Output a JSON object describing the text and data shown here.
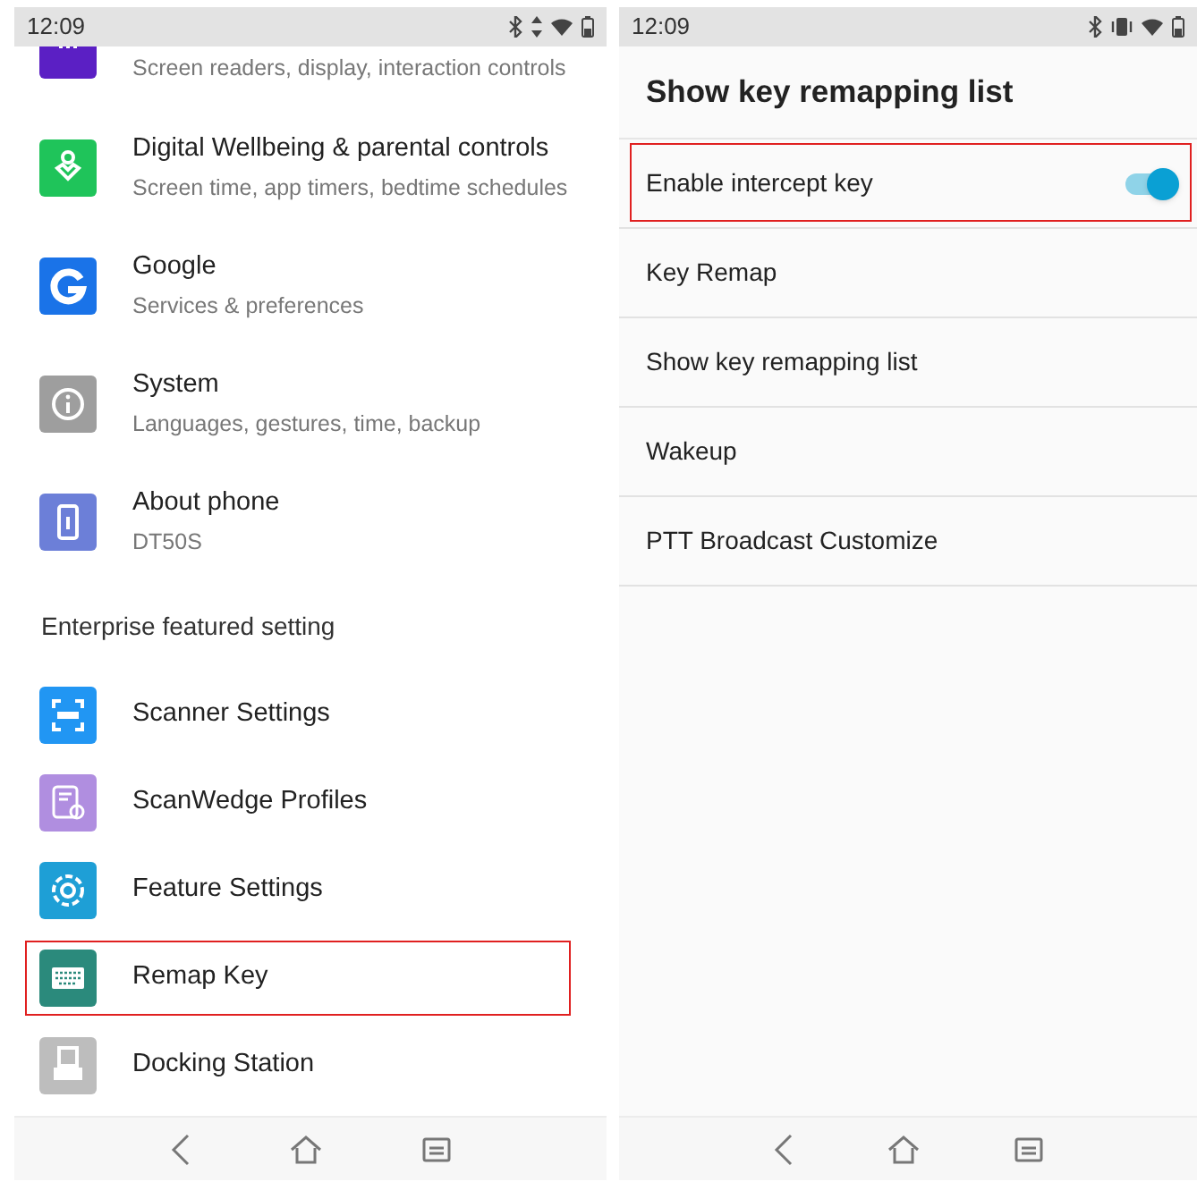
{
  "left_phone": {
    "status_bar": {
      "time": "12:09"
    },
    "items": [
      {
        "subtitle": "Screen readers, display, interaction controls",
        "color": "#5b1fc4",
        "partial": true
      },
      {
        "title": "Digital Wellbeing & parental controls",
        "subtitle": "Screen time, app timers, bedtime schedules",
        "color": "#1fc45a"
      },
      {
        "title": "Google",
        "subtitle": "Services & preferences",
        "color": "#1a73e8"
      },
      {
        "title": "System",
        "subtitle": "Languages, gestures, time, backup",
        "color": "#9e9e9e"
      },
      {
        "title": "About phone",
        "subtitle": "DT50S",
        "color": "#6c7fd8"
      }
    ],
    "section_header": "Enterprise featured setting",
    "enterprise_items": [
      {
        "title": "Scanner Settings",
        "color": "#2196f3",
        "highlighted": false
      },
      {
        "title": "ScanWedge Profiles",
        "color": "#b08ee0",
        "highlighted": false
      },
      {
        "title": "Feature Settings",
        "color": "#1e9fd6",
        "highlighted": false
      },
      {
        "title": "Remap Key",
        "color": "#2b8a7c",
        "highlighted": true
      },
      {
        "title": "Docking Station",
        "color": "#bdbdbd",
        "highlighted": false
      }
    ]
  },
  "right_phone": {
    "status_bar": {
      "time": "12:09"
    },
    "title": "Show key remapping list",
    "rows": [
      {
        "kind": "switch",
        "label": "Enable intercept key",
        "on": true,
        "highlighted": true
      },
      {
        "kind": "link",
        "label": "Key Remap",
        "highlighted": false
      },
      {
        "kind": "link",
        "label": "Show key remapping list",
        "highlighted": false
      },
      {
        "kind": "link",
        "label": "Wakeup",
        "highlighted": false
      },
      {
        "kind": "link",
        "label": "PTT Broadcast Customize",
        "highlighted": false
      }
    ]
  }
}
